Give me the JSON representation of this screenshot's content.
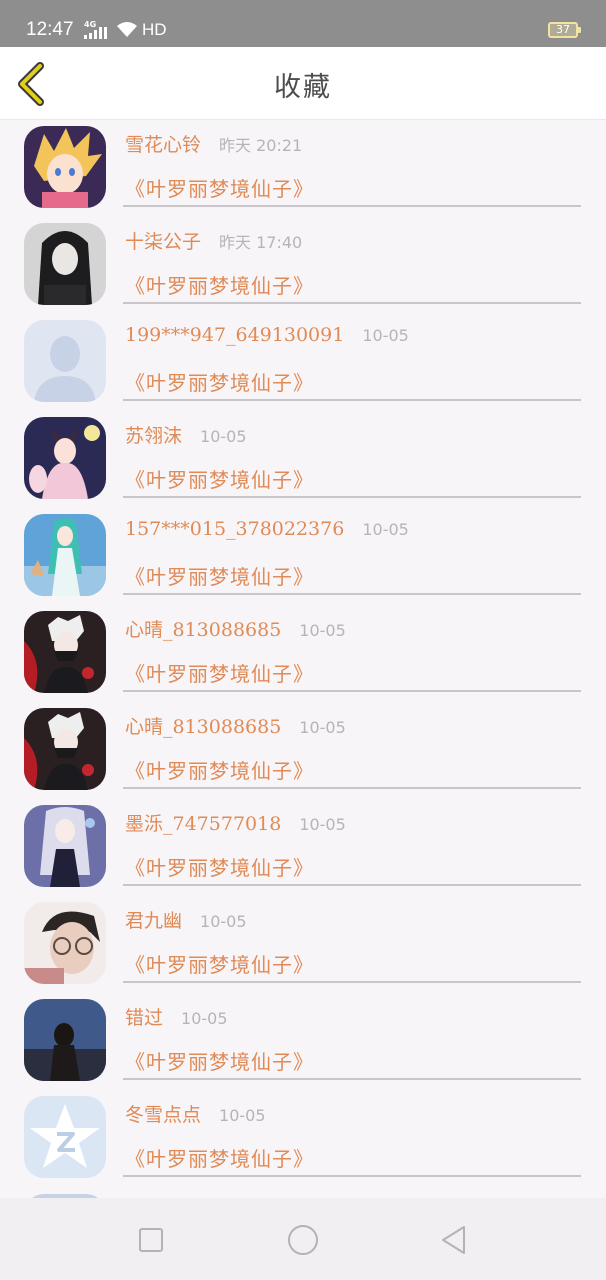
{
  "status_bar": {
    "time": "12:47",
    "network": "4G",
    "hd": "HD",
    "battery": "37"
  },
  "header": {
    "title": "收藏",
    "back_icon": "chevron-left-icon",
    "accent_color": "#e2cf1c"
  },
  "items": [
    {
      "name": "雪花心铃",
      "time": "昨天 20:21",
      "title": "《叶罗丽梦境仙子》",
      "avatar": "anime-blond-boy"
    },
    {
      "name": "十柒公子",
      "time": "昨天 17:40",
      "title": "《叶罗丽梦境仙子》",
      "avatar": "dark-hair-girl"
    },
    {
      "name": "199***947_649130091",
      "time": "10-05",
      "title": "《叶罗丽梦境仙子》",
      "avatar": "default-person"
    },
    {
      "name": "苏翎沫",
      "time": "10-05",
      "title": "《叶罗丽梦境仙子》",
      "avatar": "fox-girl"
    },
    {
      "name": "157***015_378022376",
      "time": "10-05",
      "title": "《叶罗丽梦境仙子》",
      "avatar": "teal-hair-girl"
    },
    {
      "name": "心晴_813088685",
      "time": "10-05",
      "title": "《叶罗丽梦境仙子》",
      "avatar": "white-hair-mask"
    },
    {
      "name": "心晴_813088685",
      "time": "10-05",
      "title": "《叶罗丽梦境仙子》",
      "avatar": "white-hair-mask"
    },
    {
      "name": "墨泺_747577018",
      "time": "10-05",
      "title": "《叶罗丽梦境仙子》",
      "avatar": "silver-hair-girl"
    },
    {
      "name": "君九幽",
      "time": "10-05",
      "title": "《叶罗丽梦境仙子》",
      "avatar": "glasses-boy"
    },
    {
      "name": "错过",
      "time": "10-05",
      "title": "《叶罗丽梦境仙子》",
      "avatar": "girl-back-view"
    },
    {
      "name": "冬雪点点",
      "time": "10-05",
      "title": "《叶罗丽梦境仙子》",
      "avatar": "qq-star-logo"
    }
  ],
  "nav_bar": {
    "recent_icon": "square-icon",
    "home_icon": "circle-icon",
    "back_icon": "triangle-back-icon"
  },
  "colors": {
    "name_text": "#e08a55",
    "time_text": "#b5b5b5",
    "status_bar": "#8e8e8e",
    "background": "#f7f5f8"
  }
}
